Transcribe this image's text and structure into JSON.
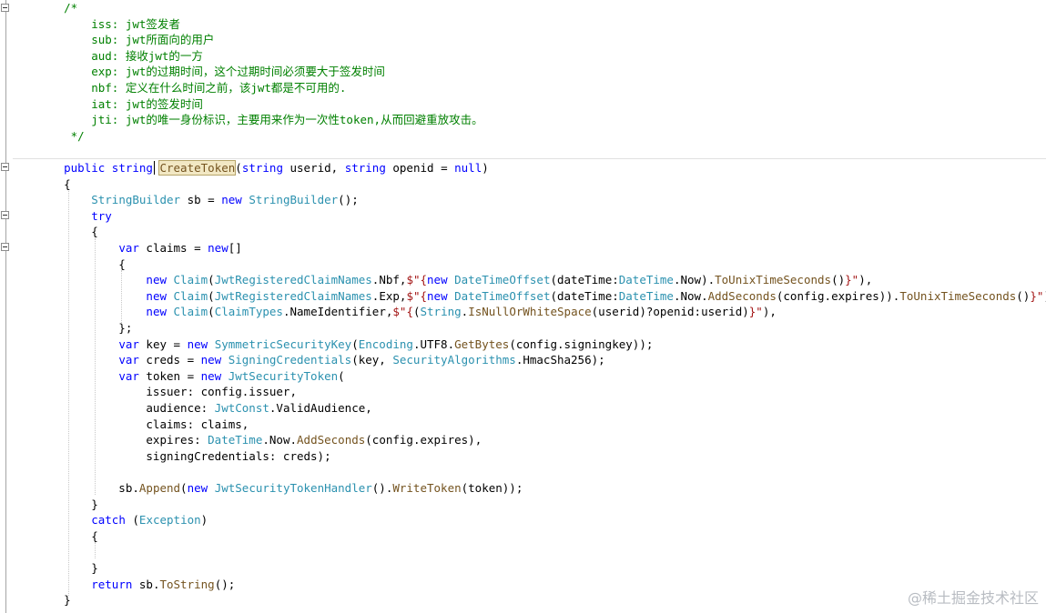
{
  "editor": {
    "lines": [
      [
        {
          "t": "    /*",
          "c": "comment"
        }
      ],
      [
        {
          "t": "        iss: jwt签发者",
          "c": "comment"
        }
      ],
      [
        {
          "t": "        sub: jwt所面向的用户",
          "c": "comment"
        }
      ],
      [
        {
          "t": "        aud: 接收jwt的一方",
          "c": "comment"
        }
      ],
      [
        {
          "t": "        exp: jwt的过期时间，这个过期时间必须要大于签发时间",
          "c": "comment"
        }
      ],
      [
        {
          "t": "        nbf: 定义在什么时间之前，该jwt都是不可用的.",
          "c": "comment"
        }
      ],
      [
        {
          "t": "        iat: jwt的签发时间",
          "c": "comment"
        }
      ],
      [
        {
          "t": "        jti: jwt的唯一身份标识，主要用来作为一次性token,从而回避重放攻击。",
          "c": "comment"
        }
      ],
      [
        {
          "t": "     */",
          "c": "comment"
        }
      ],
      [
        {
          "t": "",
          "c": "plain"
        }
      ],
      [
        {
          "t": "    ",
          "c": "plain"
        },
        {
          "t": "public",
          "c": "kw"
        },
        {
          "t": " ",
          "c": "plain"
        },
        {
          "t": "string",
          "c": "kw"
        },
        {
          "t": " ",
          "c": "plain"
        },
        {
          "t": "CreateToken",
          "c": "method",
          "hl": true
        },
        {
          "t": "(",
          "c": "plain"
        },
        {
          "t": "string",
          "c": "kw"
        },
        {
          "t": " userid, ",
          "c": "plain"
        },
        {
          "t": "string",
          "c": "kw"
        },
        {
          "t": " openid = ",
          "c": "plain"
        },
        {
          "t": "null",
          "c": "kw"
        },
        {
          "t": ")",
          "c": "plain"
        }
      ],
      [
        {
          "t": "    {",
          "c": "plain"
        }
      ],
      [
        {
          "t": "        ",
          "c": "plain"
        },
        {
          "t": "StringBuilder",
          "c": "type"
        },
        {
          "t": " sb = ",
          "c": "plain"
        },
        {
          "t": "new",
          "c": "kw"
        },
        {
          "t": " ",
          "c": "plain"
        },
        {
          "t": "StringBuilder",
          "c": "type"
        },
        {
          "t": "();",
          "c": "plain"
        }
      ],
      [
        {
          "t": "        ",
          "c": "plain"
        },
        {
          "t": "try",
          "c": "kw"
        }
      ],
      [
        {
          "t": "        {",
          "c": "plain"
        }
      ],
      [
        {
          "t": "            ",
          "c": "plain"
        },
        {
          "t": "var",
          "c": "kw"
        },
        {
          "t": " claims = ",
          "c": "plain"
        },
        {
          "t": "new",
          "c": "kw"
        },
        {
          "t": "[]",
          "c": "plain"
        }
      ],
      [
        {
          "t": "            {",
          "c": "plain"
        }
      ],
      [
        {
          "t": "                ",
          "c": "plain"
        },
        {
          "t": "new",
          "c": "kw"
        },
        {
          "t": " ",
          "c": "plain"
        },
        {
          "t": "Claim",
          "c": "type"
        },
        {
          "t": "(",
          "c": "plain"
        },
        {
          "t": "JwtRegisteredClaimNames",
          "c": "type"
        },
        {
          "t": ".Nbf,",
          "c": "plain"
        },
        {
          "t": "$\"{",
          "c": "str"
        },
        {
          "t": "new",
          "c": "kw"
        },
        {
          "t": " ",
          "c": "plain"
        },
        {
          "t": "DateTimeOffset",
          "c": "type"
        },
        {
          "t": "(dateTime:",
          "c": "plain"
        },
        {
          "t": "DateTime",
          "c": "type"
        },
        {
          "t": ".Now).",
          "c": "plain"
        },
        {
          "t": "ToUnixTimeSeconds",
          "c": "method"
        },
        {
          "t": "()",
          "c": "plain"
        },
        {
          "t": "}\"",
          "c": "str"
        },
        {
          "t": "),",
          "c": "plain"
        }
      ],
      [
        {
          "t": "                ",
          "c": "plain"
        },
        {
          "t": "new",
          "c": "kw"
        },
        {
          "t": " ",
          "c": "plain"
        },
        {
          "t": "Claim",
          "c": "type"
        },
        {
          "t": "(",
          "c": "plain"
        },
        {
          "t": "JwtRegisteredClaimNames",
          "c": "type"
        },
        {
          "t": ".Exp,",
          "c": "plain"
        },
        {
          "t": "$\"{",
          "c": "str"
        },
        {
          "t": "new",
          "c": "kw"
        },
        {
          "t": " ",
          "c": "plain"
        },
        {
          "t": "DateTimeOffset",
          "c": "type"
        },
        {
          "t": "(dateTime:",
          "c": "plain"
        },
        {
          "t": "DateTime",
          "c": "type"
        },
        {
          "t": ".Now.",
          "c": "plain"
        },
        {
          "t": "AddSeconds",
          "c": "method"
        },
        {
          "t": "(config.expires)).",
          "c": "plain"
        },
        {
          "t": "ToUnixTimeSeconds",
          "c": "method"
        },
        {
          "t": "()",
          "c": "plain"
        },
        {
          "t": "}\"",
          "c": "str"
        },
        {
          "t": "),",
          "c": "plain"
        }
      ],
      [
        {
          "t": "                ",
          "c": "plain"
        },
        {
          "t": "new",
          "c": "kw"
        },
        {
          "t": " ",
          "c": "plain"
        },
        {
          "t": "Claim",
          "c": "type"
        },
        {
          "t": "(",
          "c": "plain"
        },
        {
          "t": "ClaimTypes",
          "c": "type"
        },
        {
          "t": ".NameIdentifier,",
          "c": "plain"
        },
        {
          "t": "$\"{",
          "c": "str"
        },
        {
          "t": "(",
          "c": "plain"
        },
        {
          "t": "String",
          "c": "type"
        },
        {
          "t": ".",
          "c": "plain"
        },
        {
          "t": "IsNullOrWhiteSpace",
          "c": "method"
        },
        {
          "t": "(userid)?openid:userid)",
          "c": "plain"
        },
        {
          "t": "}\"",
          "c": "str"
        },
        {
          "t": "),",
          "c": "plain"
        }
      ],
      [
        {
          "t": "            };",
          "c": "plain"
        }
      ],
      [
        {
          "t": "            ",
          "c": "plain"
        },
        {
          "t": "var",
          "c": "kw"
        },
        {
          "t": " key = ",
          "c": "plain"
        },
        {
          "t": "new",
          "c": "kw"
        },
        {
          "t": " ",
          "c": "plain"
        },
        {
          "t": "SymmetricSecurityKey",
          "c": "type"
        },
        {
          "t": "(",
          "c": "plain"
        },
        {
          "t": "Encoding",
          "c": "type"
        },
        {
          "t": ".UTF8.",
          "c": "plain"
        },
        {
          "t": "GetBytes",
          "c": "method"
        },
        {
          "t": "(config.signingkey));",
          "c": "plain"
        }
      ],
      [
        {
          "t": "            ",
          "c": "plain"
        },
        {
          "t": "var",
          "c": "kw"
        },
        {
          "t": " creds = ",
          "c": "plain"
        },
        {
          "t": "new",
          "c": "kw"
        },
        {
          "t": " ",
          "c": "plain"
        },
        {
          "t": "SigningCredentials",
          "c": "type"
        },
        {
          "t": "(key, ",
          "c": "plain"
        },
        {
          "t": "SecurityAlgorithms",
          "c": "type"
        },
        {
          "t": ".HmacSha256);",
          "c": "plain"
        }
      ],
      [
        {
          "t": "            ",
          "c": "plain"
        },
        {
          "t": "var",
          "c": "kw"
        },
        {
          "t": " token = ",
          "c": "plain"
        },
        {
          "t": "new",
          "c": "kw"
        },
        {
          "t": " ",
          "c": "plain"
        },
        {
          "t": "JwtSecurityToken",
          "c": "type"
        },
        {
          "t": "(",
          "c": "plain"
        }
      ],
      [
        {
          "t": "                issuer: config.issuer,",
          "c": "plain"
        }
      ],
      [
        {
          "t": "                audience: ",
          "c": "plain"
        },
        {
          "t": "JwtConst",
          "c": "type"
        },
        {
          "t": ".ValidAudience,",
          "c": "plain"
        }
      ],
      [
        {
          "t": "                claims: claims,",
          "c": "plain"
        }
      ],
      [
        {
          "t": "                expires: ",
          "c": "plain"
        },
        {
          "t": "DateTime",
          "c": "type"
        },
        {
          "t": ".Now.",
          "c": "plain"
        },
        {
          "t": "AddSeconds",
          "c": "method"
        },
        {
          "t": "(config.expires),",
          "c": "plain"
        }
      ],
      [
        {
          "t": "                signingCredentials: creds);",
          "c": "plain"
        }
      ],
      [
        {
          "t": "",
          "c": "plain"
        }
      ],
      [
        {
          "t": "            sb.",
          "c": "plain"
        },
        {
          "t": "Append",
          "c": "method"
        },
        {
          "t": "(",
          "c": "plain"
        },
        {
          "t": "new",
          "c": "kw"
        },
        {
          "t": " ",
          "c": "plain"
        },
        {
          "t": "JwtSecurityTokenHandler",
          "c": "type"
        },
        {
          "t": "().",
          "c": "plain"
        },
        {
          "t": "WriteToken",
          "c": "method"
        },
        {
          "t": "(token));",
          "c": "plain"
        }
      ],
      [
        {
          "t": "        }",
          "c": "plain"
        }
      ],
      [
        {
          "t": "        ",
          "c": "plain"
        },
        {
          "t": "catch",
          "c": "kw"
        },
        {
          "t": " (",
          "c": "plain"
        },
        {
          "t": "Exception",
          "c": "type"
        },
        {
          "t": ")",
          "c": "plain"
        }
      ],
      [
        {
          "t": "        {",
          "c": "plain"
        }
      ],
      [
        {
          "t": "",
          "c": "plain"
        }
      ],
      [
        {
          "t": "        }",
          "c": "plain"
        }
      ],
      [
        {
          "t": "        ",
          "c": "plain"
        },
        {
          "t": "return",
          "c": "kw"
        },
        {
          "t": " sb.",
          "c": "plain"
        },
        {
          "t": "ToString",
          "c": "method"
        },
        {
          "t": "();",
          "c": "plain"
        }
      ],
      [
        {
          "t": "    }",
          "c": "plain"
        }
      ]
    ]
  },
  "watermark": "@稀土掘金技术社区",
  "colors": {
    "comment": "#008000",
    "keyword": "#0000ff",
    "type": "#2b91af",
    "string": "#a31515",
    "method": "#74531f"
  }
}
